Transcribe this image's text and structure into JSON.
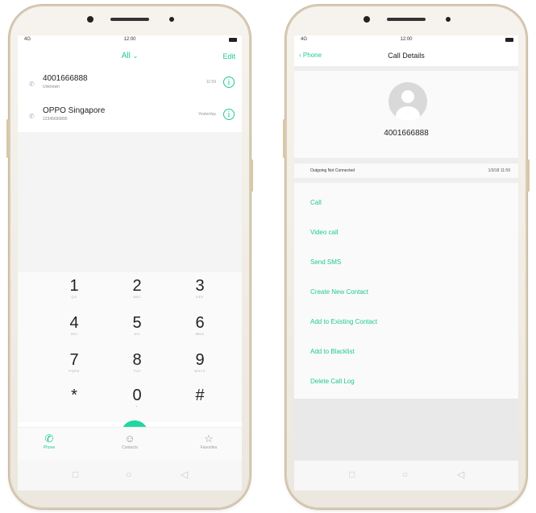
{
  "status": {
    "time": "12:00",
    "signal": "4G"
  },
  "dialer": {
    "filter_label": "All",
    "filter_chevron": "chevron-down-icon",
    "edit_label": "Edit",
    "calls": [
      {
        "name": "4001666888",
        "sub": "Unknown",
        "time": "11:59"
      },
      {
        "name": "OPPO Singapore",
        "sub": "12345690890",
        "time": "Yesterday"
      }
    ],
    "keys": [
      {
        "digit": "1",
        "letters": "QO"
      },
      {
        "digit": "2",
        "letters": "ABC"
      },
      {
        "digit": "3",
        "letters": "DEF"
      },
      {
        "digit": "4",
        "letters": "GHI"
      },
      {
        "digit": "5",
        "letters": "JKL"
      },
      {
        "digit": "6",
        "letters": "MNO"
      },
      {
        "digit": "7",
        "letters": "PQRS"
      },
      {
        "digit": "8",
        "letters": "TUV"
      },
      {
        "digit": "9",
        "letters": "WXYZ"
      },
      {
        "digit": "*",
        "letters": ""
      },
      {
        "digit": "0",
        "letters": "+"
      },
      {
        "digit": "#",
        "letters": ""
      }
    ],
    "tabs": [
      {
        "label": "Phone",
        "icon": "phone-icon"
      },
      {
        "label": "Contacts",
        "icon": "contacts-icon"
      },
      {
        "label": "Favorites",
        "icon": "star-icon"
      }
    ]
  },
  "details": {
    "back_label": "Phone",
    "title": "Call Details",
    "number": "4001666888",
    "log_type": "Outgoing Not Connected",
    "log_time": "1/3/18 11:59",
    "actions": [
      "Call",
      "Video call",
      "Send SMS",
      "Create New Contact",
      "Add to Existing Contact",
      "Add to Blacklist",
      "Delete Call Log"
    ]
  },
  "colors": {
    "accent": "#1ec997",
    "call_button": "#21d6a0"
  }
}
